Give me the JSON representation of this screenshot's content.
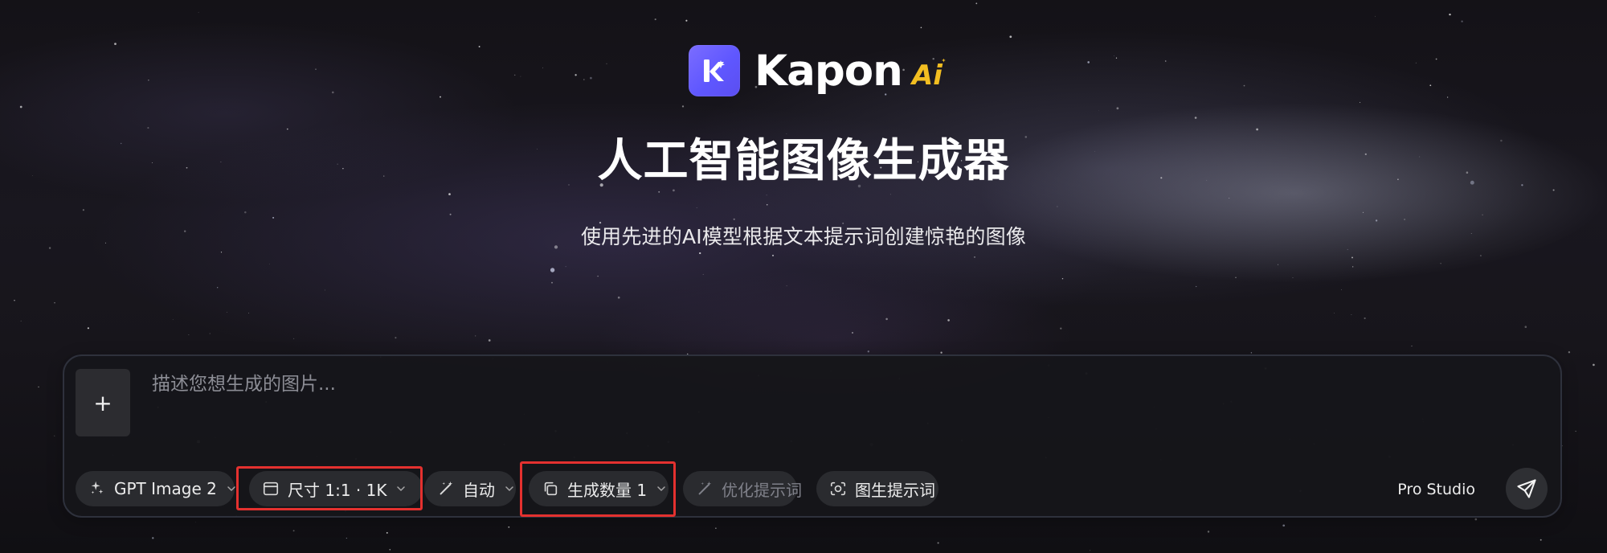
{
  "brand": {
    "name": "Kapon",
    "ai_mark": "Ai",
    "icon_name": "kapon-logo-icon",
    "accent_color": "#6a5cff",
    "ai_color": "#f2be21"
  },
  "hero": {
    "title": "人工智能图像生成器",
    "subtitle": "使用先进的AI模型根据文本提示词创建惊艳的图像"
  },
  "composer": {
    "add_button_label": "+",
    "placeholder": "描述您想生成的图片...",
    "toolbar": {
      "model": {
        "label": "GPT Image 2",
        "icon": "sparkles-icon"
      },
      "size": {
        "label": "尺寸 1:1 · 1K",
        "icon": "frame-icon"
      },
      "style": {
        "label": "自动",
        "icon": "magic-wand-icon"
      },
      "count": {
        "label": "生成数量 1",
        "icon": "copy-stack-icon"
      },
      "optimize": {
        "label": "优化提示词",
        "icon": "wand-sparkles-icon"
      },
      "image_prompt": {
        "label": "图生提示词",
        "icon": "camera-scan-icon"
      }
    },
    "pro_studio_label": "Pro Studio",
    "send_icon": "paper-plane-icon"
  },
  "highlight_color": "#e4312f"
}
